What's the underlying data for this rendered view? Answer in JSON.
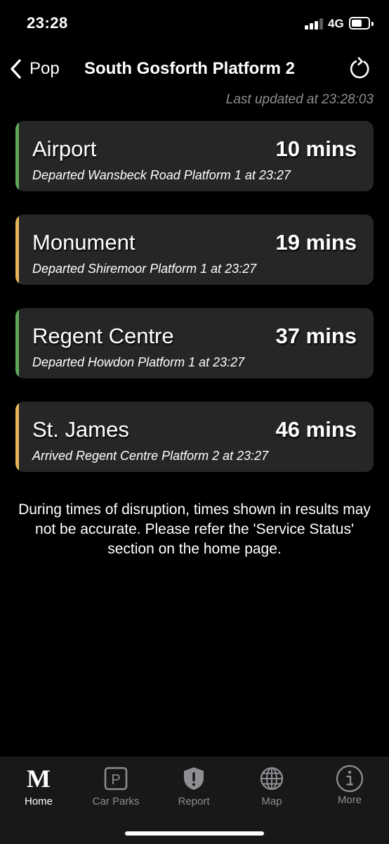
{
  "status_bar": {
    "time": "23:28",
    "network": "4G"
  },
  "nav": {
    "back_label": "Pop",
    "title": "South Gosforth Platform 2"
  },
  "last_updated": "Last updated at 23:28:03",
  "colors": {
    "green": "#5fa85a",
    "amber": "#e6b55a"
  },
  "departures": [
    {
      "destination": "Airport",
      "time": "10 mins",
      "status": "Departed Wansbeck Road Platform 1 at 23:27",
      "line_color": "#5fa85a"
    },
    {
      "destination": "Monument",
      "time": "19 mins",
      "status": "Departed Shiremoor Platform 1 at 23:27",
      "line_color": "#e6b55a"
    },
    {
      "destination": "Regent Centre",
      "time": "37 mins",
      "status": "Departed Howdon Platform 1 at 23:27",
      "line_color": "#5fa85a"
    },
    {
      "destination": "St. James",
      "time": "46 mins",
      "status": "Arrived Regent Centre Platform 2 at 23:27",
      "line_color": "#e6b55a"
    }
  ],
  "disclaimer": "During times of disruption, times shown in results may not be accurate. Please refer the 'Service Status' section on the home page.",
  "tabs": [
    {
      "label": "Home",
      "icon": "metro-m-icon",
      "logo_text": "M"
    },
    {
      "label": "Car Parks",
      "icon": "parking-icon",
      "logo_text": "P"
    },
    {
      "label": "Report",
      "icon": "shield-alert-icon"
    },
    {
      "label": "Map",
      "icon": "globe-icon"
    },
    {
      "label": "More",
      "icon": "info-icon"
    }
  ]
}
